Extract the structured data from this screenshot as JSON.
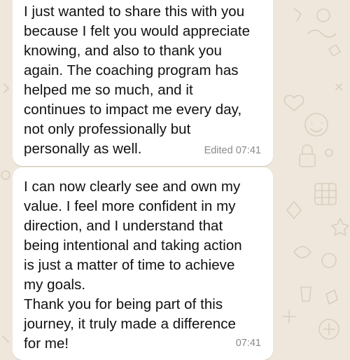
{
  "chat": {
    "background_color": "#efe7db",
    "messages": [
      {
        "text": "I just wanted to share this with you\nbecause I felt you would appreciate\nknowing, and also to thank you\nagain. The coaching program has\nhelped me so much, and it\ncontinues to impact me every day,\nnot only professionally but\npersonally as well.",
        "meta": "Edited 07:41"
      },
      {
        "text": "I can now clearly see and own my\nvalue. I feel more confident in my\ndirection, and I understand that\nbeing intentional and taking action\nis just a matter of time to achieve\nmy goals.\nThank you for being part of this\njourney, it truly made a difference\nfor me!",
        "meta": "07:41"
      }
    ]
  }
}
